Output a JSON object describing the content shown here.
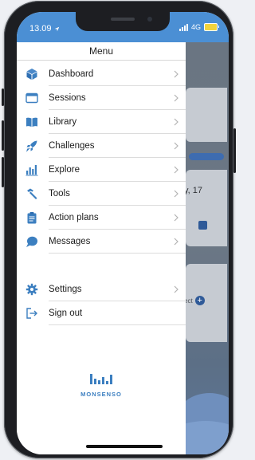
{
  "status_bar": {
    "time": "13.09",
    "network": "4G"
  },
  "menu": {
    "title": "Menu",
    "items": [
      {
        "label": "Dashboard",
        "icon": "cube-icon"
      },
      {
        "label": "Sessions",
        "icon": "window-icon"
      },
      {
        "label": "Library",
        "icon": "book-icon"
      },
      {
        "label": "Challenges",
        "icon": "rocket-icon"
      },
      {
        "label": "Explore",
        "icon": "bar-chart-icon"
      },
      {
        "label": "Tools",
        "icon": "hammer-icon"
      },
      {
        "label": "Action plans",
        "icon": "clipboard-icon"
      },
      {
        "label": "Messages",
        "icon": "chat-bubble-icon"
      }
    ],
    "secondary_items": [
      {
        "label": "Settings",
        "icon": "gear-icon"
      },
      {
        "label": "Sign out",
        "icon": "sign-out-icon"
      }
    ]
  },
  "logo": {
    "text": "MONSENSO"
  },
  "background_app": {
    "date_fragment": "y, 17",
    "button_fragment": "ect"
  },
  "colors": {
    "accent": "#3c7fc0",
    "status_bar": "#4b8fd4",
    "background_overlay": "#6b7785"
  }
}
